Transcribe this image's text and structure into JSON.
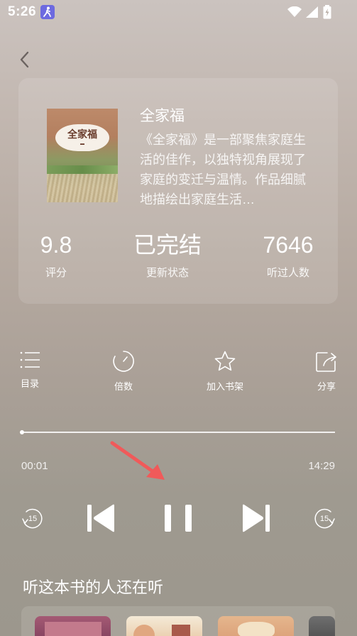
{
  "status_bar": {
    "time": "5:26",
    "app_icon": "walking-person-icon",
    "icons": [
      "wifi-icon",
      "signal-icon",
      "battery-charging-icon"
    ]
  },
  "header": {
    "back_icon": "chevron-left-icon"
  },
  "book": {
    "title": "全家福",
    "cover_title": "全家福",
    "description": "《全家福》是一部聚焦家庭生活的佳作，以独特视角展现了家庭的变迁与温情。作品细腻地描绘出家庭生活…",
    "stats": [
      {
        "value": "9.8",
        "label": "评分"
      },
      {
        "value": "已完结",
        "label": "更新状态"
      },
      {
        "value": "7646",
        "label": "听过人数"
      }
    ]
  },
  "actions": [
    {
      "label": "目录",
      "icon": "list-icon"
    },
    {
      "label": "倍数",
      "icon": "speed-dial-icon"
    },
    {
      "label": "加入书架",
      "icon": "star-icon"
    },
    {
      "label": "分享",
      "icon": "share-icon"
    }
  ],
  "player": {
    "current_time": "00:01",
    "total_time": "14:29",
    "progress": 0.0012,
    "rewind_seconds": "15",
    "forward_seconds": "15",
    "state": "playing"
  },
  "recommendations": {
    "title": "听这本书的人还在听"
  },
  "colors": {
    "annotation_arrow": "#f05a5a",
    "text": "#ffffff"
  }
}
